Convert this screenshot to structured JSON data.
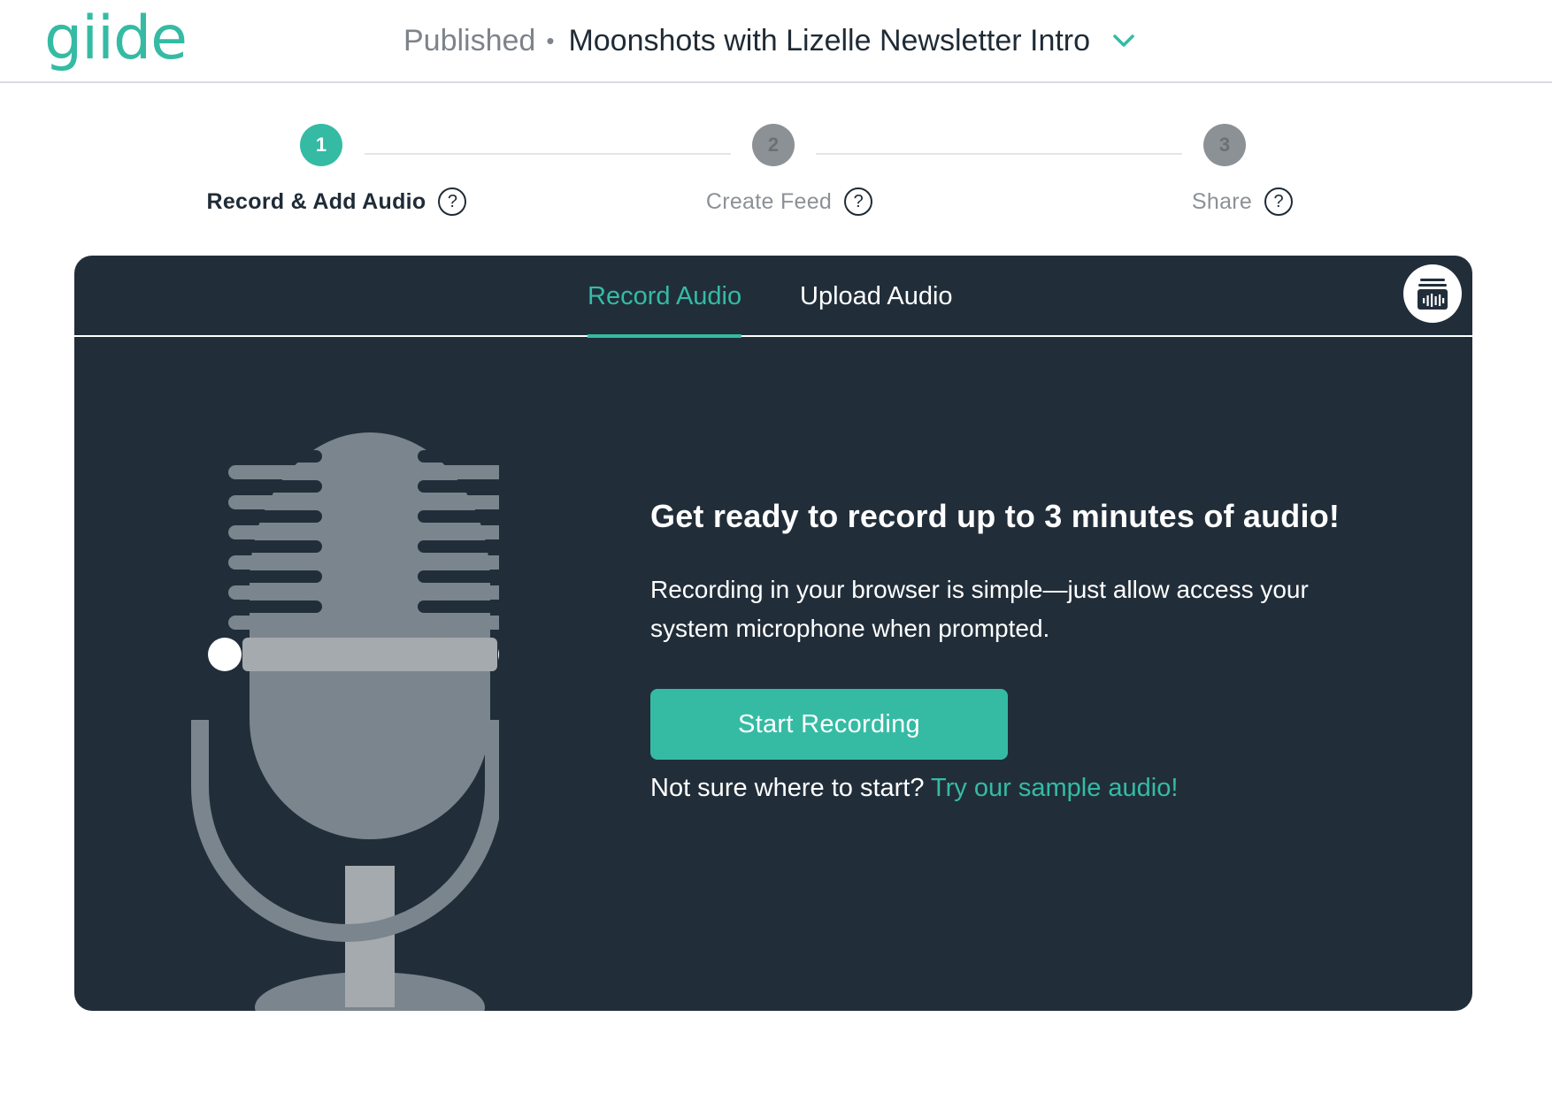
{
  "header": {
    "logo": "giide",
    "status": "Published",
    "separator": "•",
    "title": "Moonshots with Lizelle Newsletter Intro",
    "dropdown_icon": "chevron-down-icon"
  },
  "stepper": {
    "steps": [
      {
        "number": "1",
        "label": "Record & Add Audio",
        "state": "active"
      },
      {
        "number": "2",
        "label": "Create Feed",
        "state": "inactive"
      },
      {
        "number": "3",
        "label": "Share",
        "state": "inactive"
      }
    ],
    "help_glyph": "?"
  },
  "tabs": {
    "record": "Record Audio",
    "upload": "Upload Audio",
    "active": "record",
    "library_icon": "audio-library-icon"
  },
  "content": {
    "headline": "Get ready to record up to 3 minutes of audio!",
    "description": "Recording in your browser is simple—just allow access your system microphone when prompted.",
    "start_button": "Start Recording",
    "sample_prompt": "Not sure where to start?",
    "sample_link": "Try our sample audio!"
  },
  "colors": {
    "accent": "#35bba4",
    "panel_bg": "#212e3a",
    "mic_gray": "#7b858d"
  }
}
